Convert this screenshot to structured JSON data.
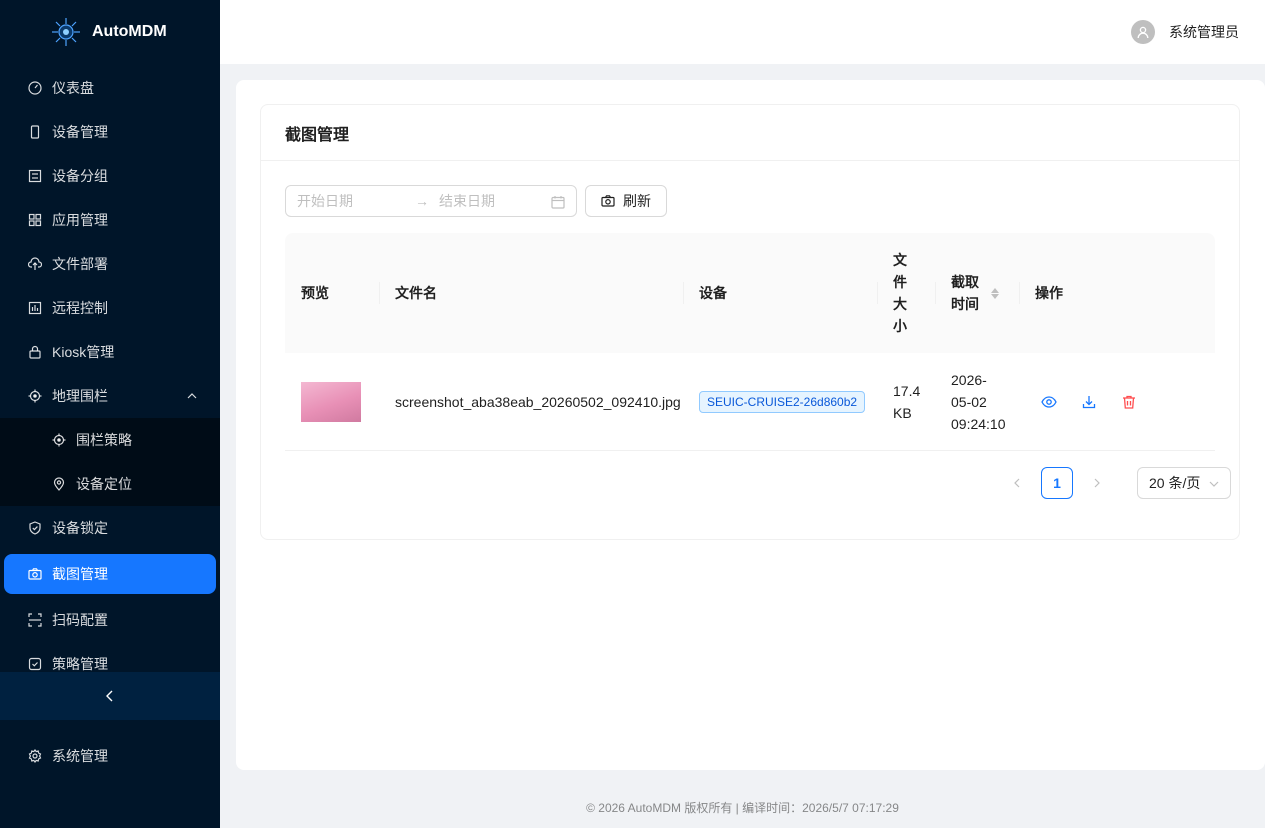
{
  "app": {
    "name": "AutoMDM"
  },
  "sidebar": {
    "items": [
      {
        "label": "仪表盘",
        "icon": "dashboard-icon"
      },
      {
        "label": "设备管理",
        "icon": "mobile-icon"
      },
      {
        "label": "设备分组",
        "icon": "group-icon"
      },
      {
        "label": "应用管理",
        "icon": "appstore-icon"
      },
      {
        "label": "文件部署",
        "icon": "cloud-upload-icon"
      },
      {
        "label": "远程控制",
        "icon": "fund-icon"
      },
      {
        "label": "Kiosk管理",
        "icon": "lock-icon"
      },
      {
        "label": "地理围栏",
        "icon": "aim-icon",
        "expanded": true
      }
    ],
    "subitems": [
      {
        "label": "围栏策略",
        "icon": "aim-icon"
      },
      {
        "label": "设备定位",
        "icon": "environment-icon"
      }
    ],
    "items_after": [
      {
        "label": "设备锁定",
        "icon": "safety-icon"
      },
      {
        "label": "截图管理",
        "icon": "camera-icon",
        "active": true
      },
      {
        "label": "扫码配置",
        "icon": "scan-icon"
      },
      {
        "label": "策略管理",
        "icon": "safety-certificate-icon"
      }
    ],
    "system": {
      "label": "系统管理",
      "icon": "setting-icon"
    }
  },
  "header": {
    "user_name": "系统管理员"
  },
  "page": {
    "title": "截图管理",
    "date_start_placeholder": "开始日期",
    "date_end_placeholder": "结束日期",
    "range_separator": "→",
    "refresh_label": "刷新"
  },
  "table": {
    "columns": {
      "preview": "预览",
      "filename": "文件名",
      "device": "设备",
      "size": "文件大小",
      "time": "截取时间",
      "actions": "操作"
    },
    "rows": [
      {
        "filename": "screenshot_aba38eab_20260502_092410.jpg",
        "device": "SEUIC-CRUISE2-26d860b2",
        "size_line1": "17.4",
        "size_line2": "KB",
        "time_line1": "2026-",
        "time_line2": "05-02",
        "time_line3": "09:24:10"
      }
    ]
  },
  "pagination": {
    "current": "1",
    "page_size": "20 条/页"
  },
  "footer": {
    "text": "© 2026 AutoMDM 版权所有 | 编译时间：2026/5/7 07:17:29"
  },
  "colors": {
    "sidebar_bg": "#001529",
    "primary": "#1677ff",
    "danger": "#ff4d4f"
  }
}
